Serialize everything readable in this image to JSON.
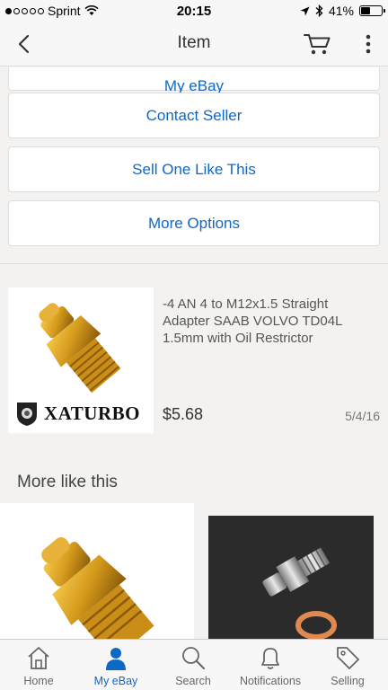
{
  "status_bar": {
    "carrier": "Sprint",
    "time": "20:15",
    "battery_text": "41%",
    "battery_level": 0.41
  },
  "nav": {
    "title": "Item"
  },
  "actions": {
    "partial_label": "My eBay",
    "contact_seller": "Contact Seller",
    "sell_one_like_this": "Sell One Like This",
    "more_options": "More Options"
  },
  "item": {
    "title": "-4 AN 4 to M12x1.5 Straight Adapter SAAB VOLVO TD04L 1.5mm with Oil Restrictor",
    "price": "$5.68",
    "date": "5/4/16",
    "brand": "XATURBO"
  },
  "more_like_this": {
    "title": "More like this"
  },
  "tab_bar": {
    "tabs": [
      {
        "label": "Home",
        "icon": "home-icon"
      },
      {
        "label": "My eBay",
        "icon": "person-icon",
        "active": true
      },
      {
        "label": "Search",
        "icon": "search-icon"
      },
      {
        "label": "Notifications",
        "icon": "bell-icon"
      },
      {
        "label": "Selling",
        "icon": "tag-icon"
      }
    ]
  },
  "colors": {
    "accent": "#0e68c6",
    "background": "#f3f2f0"
  }
}
